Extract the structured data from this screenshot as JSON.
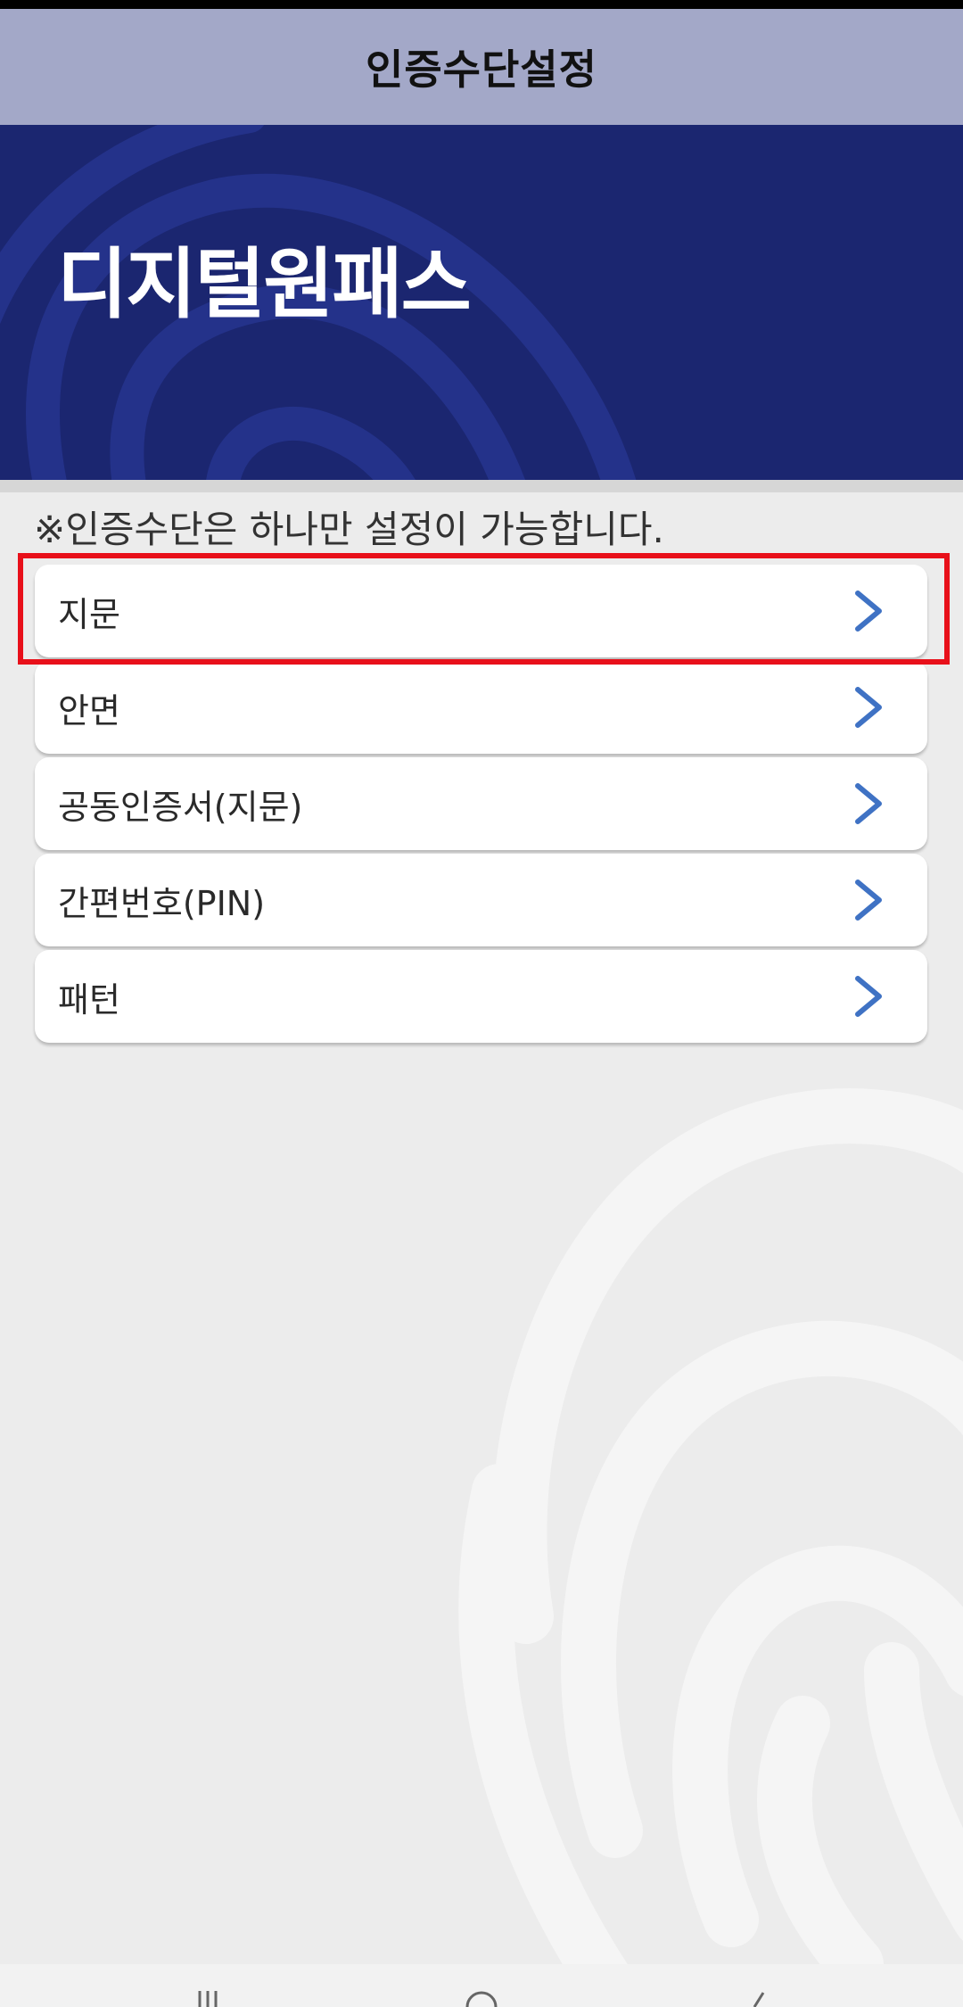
{
  "header": {
    "title": "인증수단설정"
  },
  "banner": {
    "brand": "디지털원패스"
  },
  "notice": "※인증수단은 하나만 설정이 가능합니다.",
  "menu": {
    "items": [
      {
        "label": "지문",
        "icon": "chevron-right-icon",
        "highlighted": true
      },
      {
        "label": "안면",
        "icon": "chevron-right-icon"
      },
      {
        "label": "공동인증서(지문)",
        "icon": "chevron-right-icon"
      },
      {
        "label": "간편번호(PIN)",
        "icon": "chevron-right-icon"
      },
      {
        "label": "패턴",
        "icon": "chevron-right-icon"
      }
    ]
  },
  "colors": {
    "header_bg": "#a3a8c8",
    "banner_bg": "#1b2670",
    "chevron": "#3f72c4",
    "highlight": "#e8101a",
    "page_bg": "#ececec"
  }
}
